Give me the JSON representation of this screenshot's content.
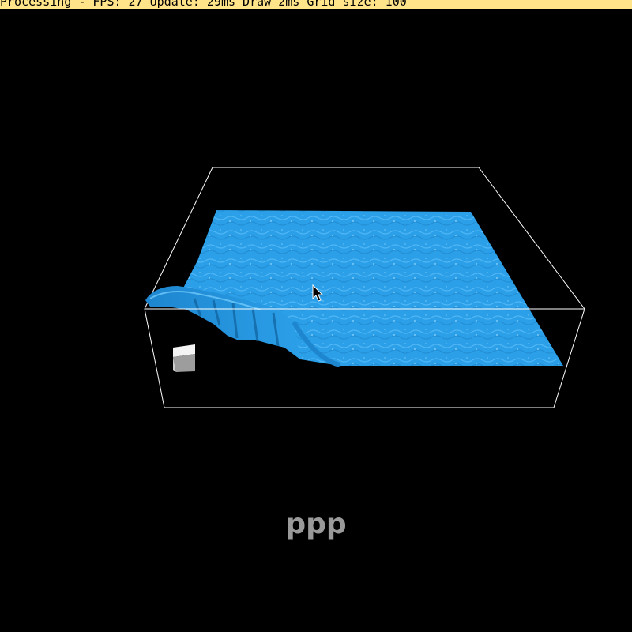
{
  "window": {
    "title": "Processing - FPS: 27 Update: 29ms Draw 2ms Grid size: 100",
    "title_bar_color": "#ffe48a"
  },
  "scene": {
    "background_color": "#000000",
    "water_color": "#2b9fe8",
    "box_edge_color": "#ffffff",
    "cube_color": "#f2f2f2",
    "objects": [
      "simulation-box",
      "water-surface",
      "wave-crest",
      "cube"
    ]
  },
  "overlay": {
    "label": "ppp"
  },
  "cursor": {
    "icon": "arrow-cursor-icon"
  }
}
